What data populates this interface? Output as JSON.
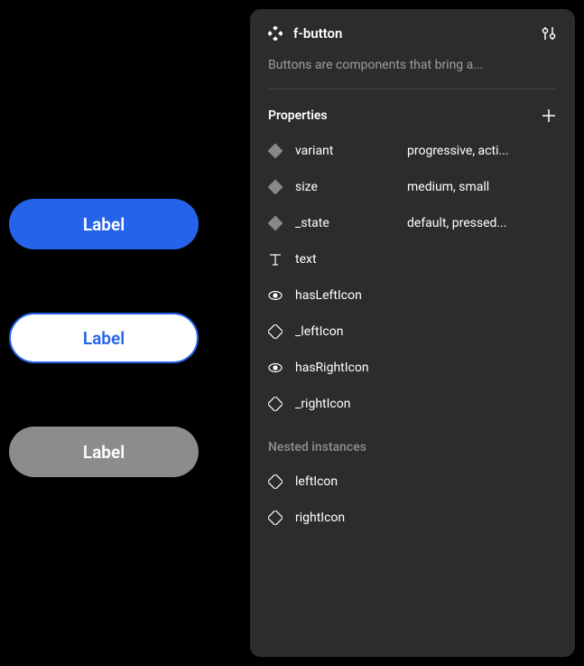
{
  "canvas": {
    "buttons": [
      {
        "label": "Label",
        "variant": "progressive"
      },
      {
        "label": "Label",
        "variant": "outline"
      },
      {
        "label": "Label",
        "variant": "disabled"
      }
    ]
  },
  "panel": {
    "title": "f-button",
    "description": "Buttons are components that bring a...",
    "properties_title": "Properties",
    "properties": [
      {
        "icon": "variant",
        "name": "variant",
        "value": "progressive, acti..."
      },
      {
        "icon": "variant",
        "name": "size",
        "value": "medium, small"
      },
      {
        "icon": "variant",
        "name": "_state",
        "value": "default, pressed..."
      },
      {
        "icon": "text",
        "name": "text",
        "value": ""
      },
      {
        "icon": "boolean",
        "name": "hasLeftIcon",
        "value": ""
      },
      {
        "icon": "instance",
        "name": "_leftIcon",
        "value": ""
      },
      {
        "icon": "boolean",
        "name": "hasRightIcon",
        "value": ""
      },
      {
        "icon": "instance",
        "name": "_rightIcon",
        "value": ""
      }
    ],
    "nested_title": "Nested instances",
    "nested": [
      {
        "icon": "instance",
        "name": "leftIcon"
      },
      {
        "icon": "instance",
        "name": "rightIcon"
      }
    ]
  }
}
